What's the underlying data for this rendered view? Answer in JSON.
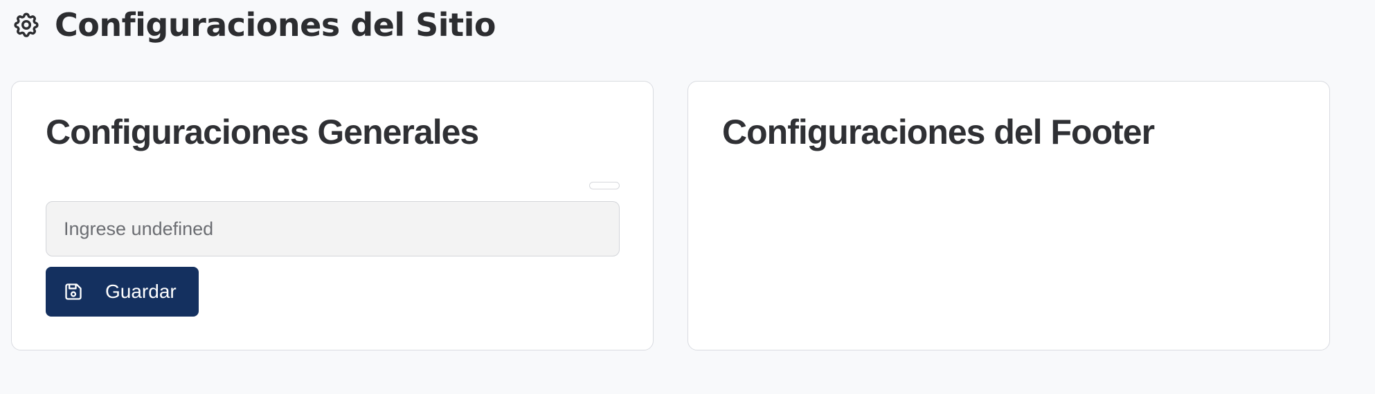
{
  "header": {
    "title": "Configuraciones del Sitio",
    "icon": "gear-icon"
  },
  "general_card": {
    "title": "Configuraciones Generales",
    "input": {
      "value": "",
      "placeholder": "Ingrese undefined"
    },
    "save_button": {
      "label": "Guardar",
      "icon": "floppy-disk-icon"
    }
  },
  "footer_card": {
    "title": "Configuraciones del Footer"
  },
  "colors": {
    "background": "#f8f9fb",
    "card": "#ffffff",
    "primary_button": "#14305f",
    "input_background": "#f3f3f3"
  }
}
